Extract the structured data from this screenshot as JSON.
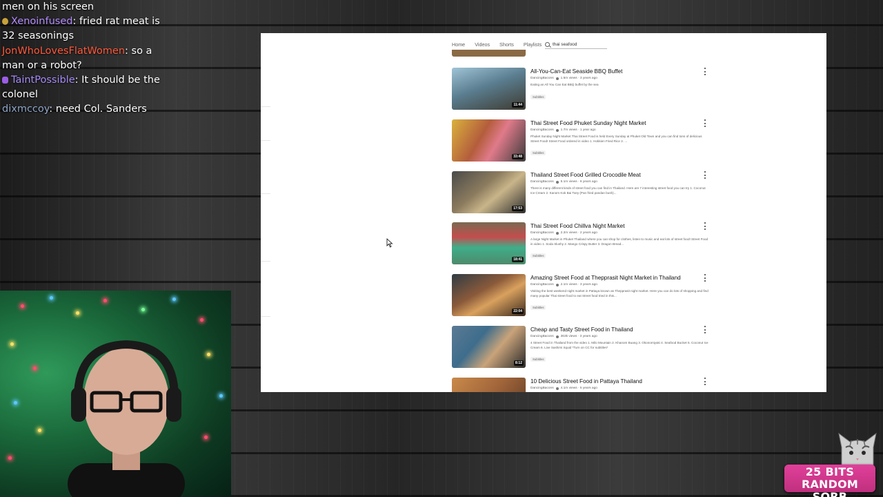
{
  "chat": {
    "messages": [
      {
        "user": "",
        "text": "men on his screen",
        "color": "#ffffff",
        "badge": ""
      },
      {
        "user": "Xenoinfused",
        "text": ": fried rat meat is 32 seasonings",
        "color": "#b48cff",
        "badge": "#c9a23a"
      },
      {
        "user": "JonWhoLovesFlatWomen",
        "text": ": so a man or a robot?",
        "color": "#ff5a3c",
        "badge": ""
      },
      {
        "user": "TaintPossible",
        "text": ": It should be the colonel",
        "color": "#a78bfa",
        "badge": "#9b5de5"
      },
      {
        "user": "dixmccoy",
        "text": ": need Col. Sanders",
        "color": "#8fa7c9",
        "badge": ""
      }
    ]
  },
  "youtube": {
    "nav": {
      "home": "Home",
      "videos": "Videos",
      "shorts": "Shorts",
      "playlists": "Playlists"
    },
    "search": {
      "value": "thai seafood"
    },
    "videos": [
      {
        "title": "All-You-Can-Eat Seaside BBQ Buffet",
        "channel": "DancingBacons",
        "stats": "1.5m views · 3 years ago",
        "desc": "Eating an All You Can Eat BBQ buffet by the sea",
        "badge": "Subtitles",
        "duration": "11:44",
        "color": "#5a7d8f"
      },
      {
        "title": "Thai Street Food Phuket Sunday Night Market",
        "channel": "DancingBacons",
        "stats": "1.7m views · 1 year ago",
        "desc": "Phuket Sunday Night Market Thai Street Food is held Every Sunday at Phuket Old Town and you can find tons of delicious Street Food! Street Food ordered in video 1. Hokkien Fried Rice 2. ...",
        "badge": "Subtitles",
        "duration": "33:48",
        "color": "#b45d3c"
      },
      {
        "title": "Thailand Street Food Grilled Crocodile Meat",
        "channel": "DancingBacons",
        "stats": "5.1m views · 6 years ago",
        "desc": "There is many different kinds of street food you can find in Thailand. Here are 7 interesting street food you can try 1. Coconut Ice Cream 2. Kanom Kok Bai Toey (Pan fried pandan bush)...",
        "badge": "",
        "duration": "17:53",
        "color": "#6b5a48"
      },
      {
        "title": "Thai Street Food Chillva Night Market",
        "channel": "DancingBacons",
        "stats": "2.2m views · 2 years ago",
        "desc": "A large Night Market in Phuket Thailand where you can shop for clothes, listen to music and eat lots of street food! Street Food in video 1. Soda Slushy 2. Mango Crispy Butter 3. Dragon Bread...",
        "badge": "Subtitles",
        "duration": "18:41",
        "color": "#4d8a6a"
      },
      {
        "title": "Amazing Street Food at Thepprasit Night Market in Thailand",
        "channel": "DancingBacons",
        "stats": "2.1m views · 3 years ago",
        "desc": "Visiting the best weekend night market in Pattaya known as Thepprasit night market. Here you can do lots of shopping and find many popular Thai street food to eat Street food tried in this...",
        "badge": "Subtitles",
        "duration": "22:04",
        "color": "#8a5a3a"
      },
      {
        "title": "Cheap and Tasty Street Food in Thailand",
        "channel": "DancingBacons",
        "stats": "363k views · 3 years ago",
        "desc": "4 Street Food in Thailand from the video 1. Milo Mountain 2. Khanom Buang 3. Okonomiyaki 4. Seafood Bucket 5. Coconut Ice Cream 6. Live Sashimi Squid *Turn on CC for subtitles*",
        "badge": "Subtitles",
        "duration": "8:12",
        "color": "#3e6d8c"
      },
      {
        "title": "10 Delicious Street Food in Pattaya Thailand",
        "channel": "DancingBacons",
        "stats": "4.1m views · 5 years ago",
        "desc": "",
        "badge": "",
        "duration": "",
        "color": "#a0643a"
      }
    ]
  },
  "bits_alert": {
    "line1": "25 BITS",
    "line2": "RANDOM SORB",
    "color": "#d6378c"
  }
}
